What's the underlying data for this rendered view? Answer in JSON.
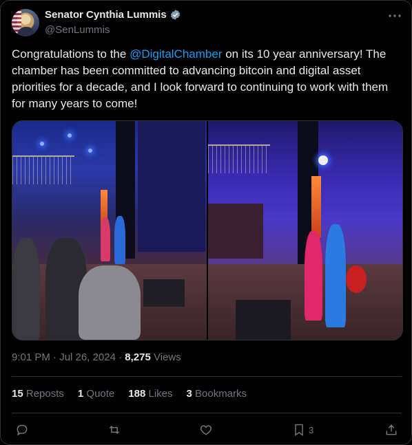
{
  "author": {
    "name": "Senator Cynthia Lummis",
    "handle": "@SenLummis"
  },
  "tweet": {
    "text_before": "Congratulations to the ",
    "mention": "@DigitalChamber",
    "text_after": " on its 10 year anniversary! The chamber has been committed to advancing bitcoin and digital asset priorities for a decade, and I look forward to continuing to work with them for many years to come!"
  },
  "meta": {
    "time": "9:01 PM",
    "separator1": " · ",
    "date": "Jul 26, 2024",
    "separator2": " · ",
    "views_count": "8,275",
    "views_label": " Views"
  },
  "stats": {
    "reposts_count": "15",
    "reposts_label": "Reposts",
    "quotes_count": "1",
    "quotes_label": "Quote",
    "likes_count": "188",
    "likes_label": "Likes",
    "bookmarks_count": "3",
    "bookmarks_label": "Bookmarks"
  },
  "actions": {
    "bookmark_count": "3"
  },
  "icons": [
    "verified-badge-icon",
    "more-icon",
    "reply-icon",
    "repost-icon",
    "like-icon",
    "bookmark-icon",
    "share-icon"
  ],
  "colors": {
    "accent": "#1d9bf0",
    "muted": "#71767b",
    "text": "#e7e9ea",
    "border": "#2f3336",
    "background": "#000000"
  }
}
